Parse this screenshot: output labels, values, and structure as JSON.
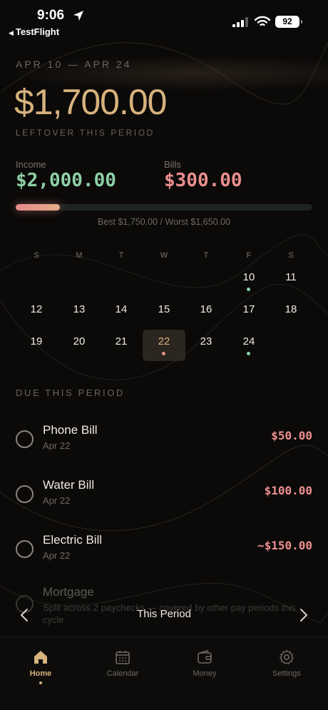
{
  "status_bar": {
    "time": "9:06",
    "back_app": "TestFlight",
    "battery": "92"
  },
  "summary": {
    "period": "APR 10 — APR 24",
    "leftover_amount": "$1,700.00",
    "leftover_label": "LEFTOVER THIS PERIOD",
    "income_label": "Income",
    "income_value": "$2,000.00",
    "bills_label": "Bills",
    "bills_value": "$300.00",
    "progress_fraction": 0.15,
    "forecast": "Best $1,750.00 / Worst $1,650.00"
  },
  "calendar": {
    "weekdays": [
      "S",
      "M",
      "T",
      "W",
      "T",
      "F",
      "S"
    ],
    "week1": {
      "fri": "10",
      "sat": "11"
    },
    "week2": [
      "12",
      "13",
      "14",
      "15",
      "16",
      "17",
      "18"
    ],
    "week3": {
      "sun": "19",
      "mon": "20",
      "tue": "21",
      "wed": "22",
      "thu": "23",
      "fri": "24"
    },
    "dot_colors": {
      "income": "#8ed1a6",
      "bill": "#ec8f8f"
    }
  },
  "due": {
    "title": "DUE THIS PERIOD",
    "bills": [
      {
        "name": "Phone Bill",
        "date": "Apr 22",
        "amount": "$50.00"
      },
      {
        "name": "Water Bill",
        "date": "Apr 22",
        "amount": "$100.00"
      },
      {
        "name": "Electric Bill",
        "date": "Apr 22",
        "amount": "~$150.00"
      }
    ],
    "mortgage": {
      "name": "Mortgage",
      "note": "Split across 2 paychecks — covered by other pay periods this cycle"
    }
  },
  "period_nav": {
    "label": "This Period"
  },
  "tabs": [
    {
      "label": "Home",
      "icon": "home-icon"
    },
    {
      "label": "Calendar",
      "icon": "calendar-icon"
    },
    {
      "label": "Money",
      "icon": "wallet-icon"
    },
    {
      "label": "Settings",
      "icon": "gear-icon"
    }
  ],
  "colors": {
    "accent": "#d7b27c",
    "income": "#8ed1a6",
    "bill": "#ec8f8f",
    "background": "#0b0a09"
  }
}
